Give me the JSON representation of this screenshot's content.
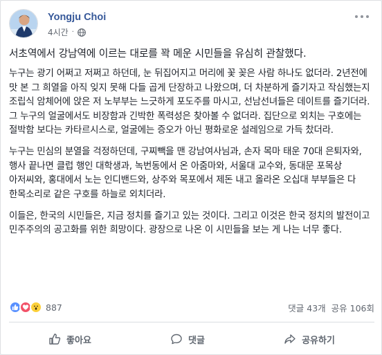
{
  "author": {
    "name": "Yongju Choi",
    "time": "4시간",
    "separator": "·"
  },
  "post": {
    "paragraphs": [
      "서초역에서 강남역에 이르는 대로를 꽉 메운 시민들을 유심히 관찰했다.",
      "누구는 광기 어쩌고 저쩌고 하던데, 눈 뒤집어지고 머리에 꽃 꽂은 사람 하나도 없더라. 2년전에 맛 본 그 희열을 아직 잊지 못해 다들 곱게 단장하고 나왔으며, 더 차분하게 즐기자고 작심했는지 조립식 암체어에 앉은 저 노부부는 느긋하게 포도주를 마시고, 선남선녀들은 데이트를 즐기더라. 그 누구의 얼굴에서도 비장함과 긴박한 폭력성은 찾아볼 수 없더라. 집단으로 외치는 구호에는 절박함 보다는 카타르시스로, 얼굴에는 증오가 아닌 평화로운 설레임으로 가득 찼더라.",
      "누구는 민심의 분열을 걱정하던데, 구찌빽을 맨 강남여사님과, 손자 목마 태운 70대 은퇴자와, 행사 끝나면 클럽 행인 대학생과, 녹번동에서 온 아줌마와, 서울대 교수와, 동대문 포목상 아저씨와, 홍대에서 노는 인디밴드와, 상주와 목포에서 제돈 내고 올라온 오십대 부부들은 다 한목소리로 같은 구호를 하늘로 외치더라.",
      "이들은, 한국의 시민들은, 지금 정치를 즐기고 있는 것이다. 그리고 이것은 한국 정치의 발전이고 민주주의의 공고화를 위한 희망이다. 광장으로 나온 이 시민들을 보는 게 나는 너무 좋다."
    ]
  },
  "stats": {
    "reaction_count": "887",
    "comments": "댓글 43개",
    "shares": "공유 106회"
  },
  "actions": {
    "like": "좋아요",
    "comment": "댓글",
    "share": "공유하기"
  },
  "colors": {
    "name": "#365899",
    "like": "#5890ff",
    "love": "#f25268",
    "wow": "#fcd03a"
  },
  "icons": [
    "avatar",
    "globe-icon",
    "more-icon",
    "like-reaction-icon",
    "love-reaction-icon",
    "wow-reaction-icon",
    "thumbs-up-icon",
    "comment-icon",
    "share-icon"
  ]
}
